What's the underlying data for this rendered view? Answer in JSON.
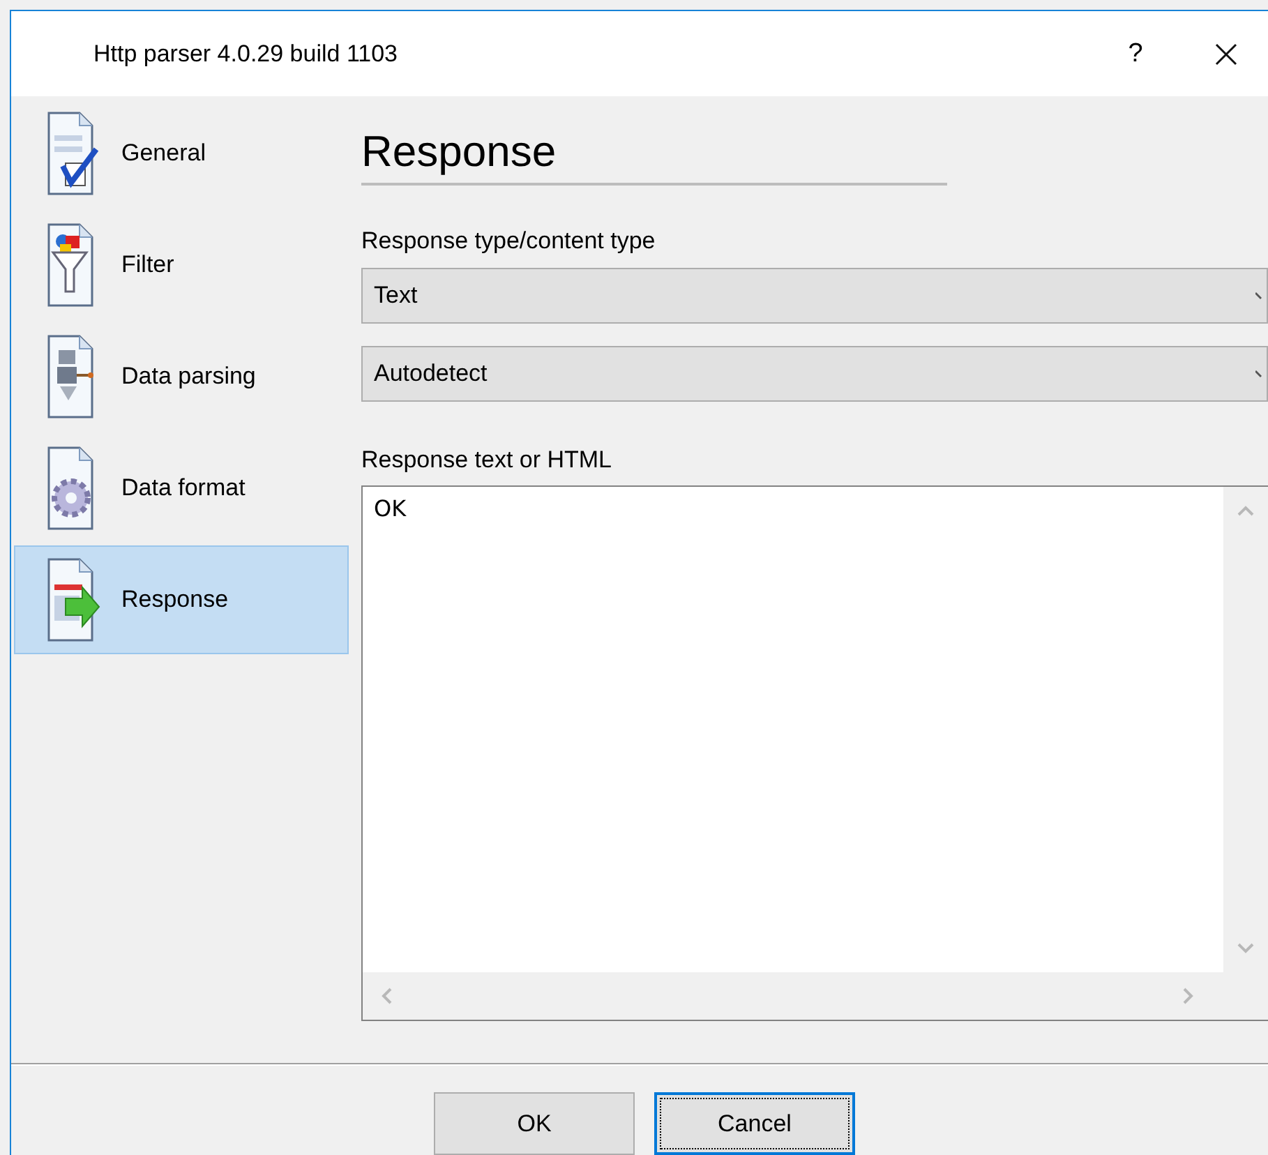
{
  "window": {
    "title": "Http parser 4.0.29 build 1103",
    "help": "?"
  },
  "sidebar": {
    "items": [
      {
        "label": "General",
        "kind": "general",
        "selected": false
      },
      {
        "label": "Filter",
        "kind": "filter",
        "selected": false
      },
      {
        "label": "Data parsing",
        "kind": "parsing",
        "selected": false
      },
      {
        "label": "Data format",
        "kind": "format",
        "selected": false
      },
      {
        "label": "Response",
        "kind": "response",
        "selected": true
      }
    ]
  },
  "page": {
    "heading": "Response",
    "type_label": "Response type/content type",
    "dropdowns": [
      {
        "value": "Text"
      },
      {
        "value": "Autodetect"
      }
    ],
    "text_label": "Response text or HTML",
    "text_value": "OK"
  },
  "buttons": [
    {
      "label": "OK",
      "focused": false
    },
    {
      "label": "Cancel",
      "focused": true
    }
  ]
}
